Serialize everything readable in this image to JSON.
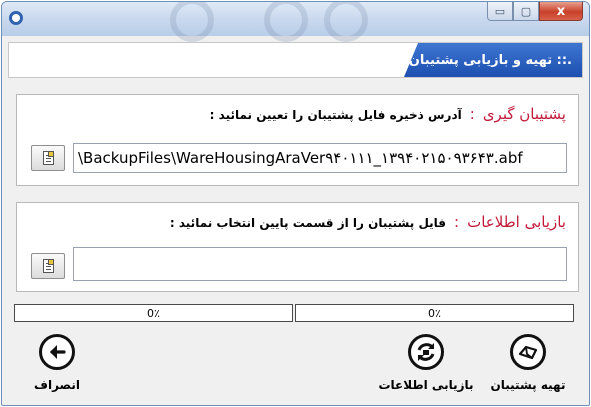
{
  "window": {
    "title": "",
    "controls": {
      "minimize": "▭",
      "maximize": "▢",
      "close": "x"
    },
    "colors": {
      "titlebar": "#c9d9ee",
      "accent": "#1d4fb0",
      "header_text": "#ffffff",
      "section_title": "#c41a3a"
    }
  },
  "header": {
    "title": ".:: تهیه و بازیابی پشتیبان"
  },
  "backup": {
    "title": "پشتیبان گیری",
    "colon": ":",
    "instruction": "آدرس ذخیره فایل پشتیبان را تعیین نمائید :",
    "path": "\\BackupFiles\\WareHousingAraVer۹۴۰۱۱۱_۱۳۹۴۰۲۱۵۰۹۳۶۴۳.abf",
    "browse_icon": "document-icon"
  },
  "restore": {
    "title": "بازیابی اطلاعات",
    "colon": ":",
    "instruction": "فایل پشتیبان را از قسمت پایین انتخاب نمائید :",
    "path": "",
    "browse_icon": "document-icon"
  },
  "progress": {
    "left": {
      "value": 0,
      "label": "0٪"
    },
    "right": {
      "value": 0,
      "label": "0٪"
    }
  },
  "actions": {
    "backup": {
      "label": "تهیه پشتیبان",
      "icon": "backup-icon"
    },
    "restore": {
      "label": "بازیابی اطلاعات",
      "icon": "restore-icon"
    },
    "cancel": {
      "label": "انصراف",
      "icon": "back-arrow-icon"
    }
  }
}
